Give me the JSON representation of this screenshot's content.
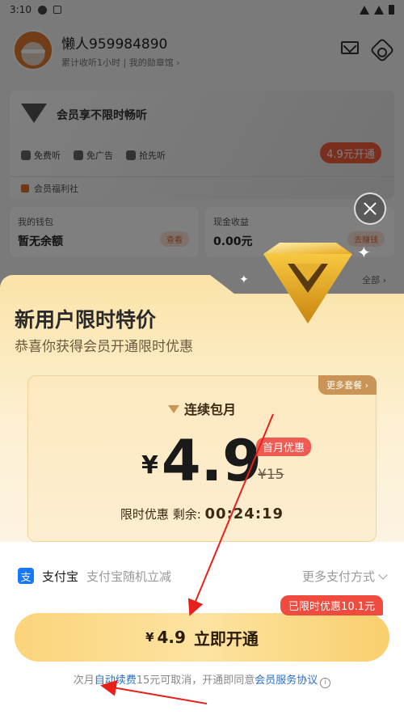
{
  "status_bar": {
    "time": "3:10"
  },
  "profile": {
    "name": "懒人959984890",
    "listen_time": "累计收听1小时",
    "badge_link": "我的勋章馆"
  },
  "vip_card": {
    "title": "会员享不限时畅听",
    "features": [
      "免费听",
      "免广告",
      "抢先听"
    ],
    "open_button": "4.9元开通",
    "welfare": "会员福利社"
  },
  "wallet": {
    "label": "我的钱包",
    "value": "暂无余额",
    "action": "查看"
  },
  "income": {
    "label": "现金收益",
    "value": "0.00元",
    "action": "去赚钱"
  },
  "all_link": "全部",
  "modal": {
    "headline": "新用户限时特价",
    "subline": "恭喜你获得会员开通限时优惠",
    "more_plans": "更多套餐",
    "plan_name": "连续包月",
    "currency": "¥",
    "price": "4.9",
    "first_month_badge": "首月优惠",
    "original_price": "¥15",
    "countdown_label": "限时优惠 剩余:",
    "countdown_value": "00:24:19",
    "payment": {
      "name": "支付宝",
      "desc": "支付宝随机立减",
      "more": "更多支付方式",
      "icon_char": "支"
    },
    "limit_tag": "已限时优惠10.1元",
    "cta_currency": "¥",
    "cta_amount": "4.9",
    "cta_label": "立即开通",
    "footer": {
      "prefix": "次月",
      "auto_renew": "自动续费",
      "middle": "15元可取消，开通即同意",
      "agreement": "会员服务协议"
    }
  },
  "colors": {
    "accent_red": "#ef4b3f",
    "link_blue": "#2a6fcf",
    "annotation_red": "#e8201a"
  }
}
